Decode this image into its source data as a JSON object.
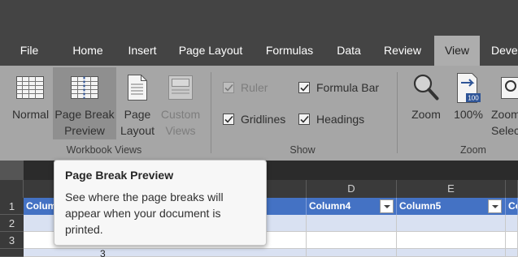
{
  "tabs": [
    {
      "label": "File"
    },
    {
      "label": "Home"
    },
    {
      "label": "Insert"
    },
    {
      "label": "Page Layout"
    },
    {
      "label": "Formulas"
    },
    {
      "label": "Data"
    },
    {
      "label": "Review"
    },
    {
      "label": "View",
      "active": true
    },
    {
      "label": "Deve"
    }
  ],
  "ribbon": {
    "workbook_views": {
      "group_label": "Workbook Views",
      "normal": "Normal",
      "page_break_preview": {
        "line1": "Page Break",
        "line2": "Preview"
      },
      "page_layout": {
        "line1": "Page",
        "line2": "Layout"
      },
      "custom_views": {
        "line1": "Custom",
        "line2": "Views"
      }
    },
    "show": {
      "group_label": "Show",
      "ruler": {
        "label": "Ruler",
        "checked": true,
        "disabled": true
      },
      "formula_bar": {
        "label": "Formula Bar",
        "checked": true
      },
      "gridlines": {
        "label": "Gridlines",
        "checked": true
      },
      "headings": {
        "label": "Headings",
        "checked": true
      }
    },
    "zoom": {
      "group_label": "Zoom",
      "zoom": "Zoom",
      "zoom_100": "100%",
      "zoom_100_icon_text": "100",
      "zoom_to_selection": {
        "line1": "Zoom",
        "line2": "Selec"
      }
    }
  },
  "sheet": {
    "column_letters": [
      "D",
      "E"
    ],
    "row_numbers": [
      "1",
      "2",
      "3"
    ],
    "table_headers": [
      "Colum",
      "Column4",
      "Column5",
      "Co"
    ],
    "partial_value": "3"
  },
  "tooltip": {
    "title": "Page Break Preview",
    "body": "See where the page breaks will appear when your document is printed."
  },
  "colors": {
    "title_bar": "#444444",
    "ribbon": "#a6a6a6",
    "table_header": "#4472c4",
    "banded_row": "#d9e1f2"
  }
}
